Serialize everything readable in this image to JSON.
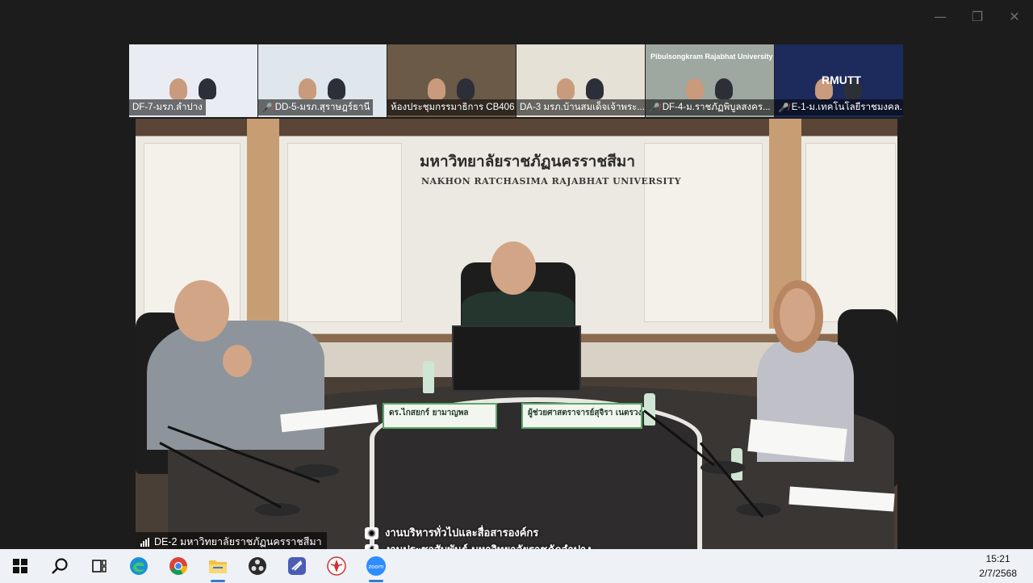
{
  "window": {
    "controls": {
      "minimize": "—",
      "restore": "❐",
      "close": "✕"
    }
  },
  "gallery": [
    {
      "label": "DF-7-มรภ.ลำปาง",
      "muted": false,
      "bg": "#e9edf3",
      "thumb_text": ""
    },
    {
      "label": "DD-5-มรภ.สุราษฎร์ธานี",
      "muted": true,
      "bg": "#dfe6ec",
      "thumb_text": ""
    },
    {
      "label": "ห้องประชุมกรรมาธิการ CB406",
      "muted": false,
      "bg": "#6b5a47",
      "thumb_text": ""
    },
    {
      "label": "DA-3 มรภ.บ้านสมเด็จเจ้าพระ...",
      "muted": false,
      "bg": "#e5e1d6",
      "thumb_text": ""
    },
    {
      "label": "DF-4-ม.ราชภัฏพิบูลสงคร...",
      "muted": true,
      "bg": "#9ea7a0",
      "thumb_text": "Pibulsongkram Rajabhat University"
    },
    {
      "label": "E-1-ม.เทคโนโลยีราชมงคล...",
      "muted": true,
      "bg": "#1d2a5c",
      "thumb_text": "RMUTT"
    }
  ],
  "main_video": {
    "sign_th": "มหาวิทยาลัยราชภัฏนครราชสีมา",
    "sign_en": "NAKHON RATCHASIMA RAJABHAT UNIVERSITY",
    "nameplate_left": "ดร.ไกสยกร์ ยามาญพล",
    "nameplate_right": "ผู้ช่วยศาสตราจารย์สุจิรา เนตรวง",
    "speaker_label": "DE-2 มหาวิทยาลัยราชภัฏนครราชสีมา",
    "credit_line1": "งานบริหารทั่วไปและสื่อสารองค์กร",
    "credit_line2": "งานประชาสัมพันธ์ มหาวิทยาลัยราชภัฏลำปาง"
  },
  "taskbar": {
    "icons": [
      "windows-start-icon",
      "search-icon",
      "task-view-icon",
      "edge-icon",
      "chrome-icon",
      "file-explorer-icon",
      "obs-icon",
      "app-icon",
      "emblem-app-icon",
      "zoom-icon"
    ],
    "zoom_text": "zoom",
    "time": "15:21",
    "date": "2/7/2568"
  }
}
